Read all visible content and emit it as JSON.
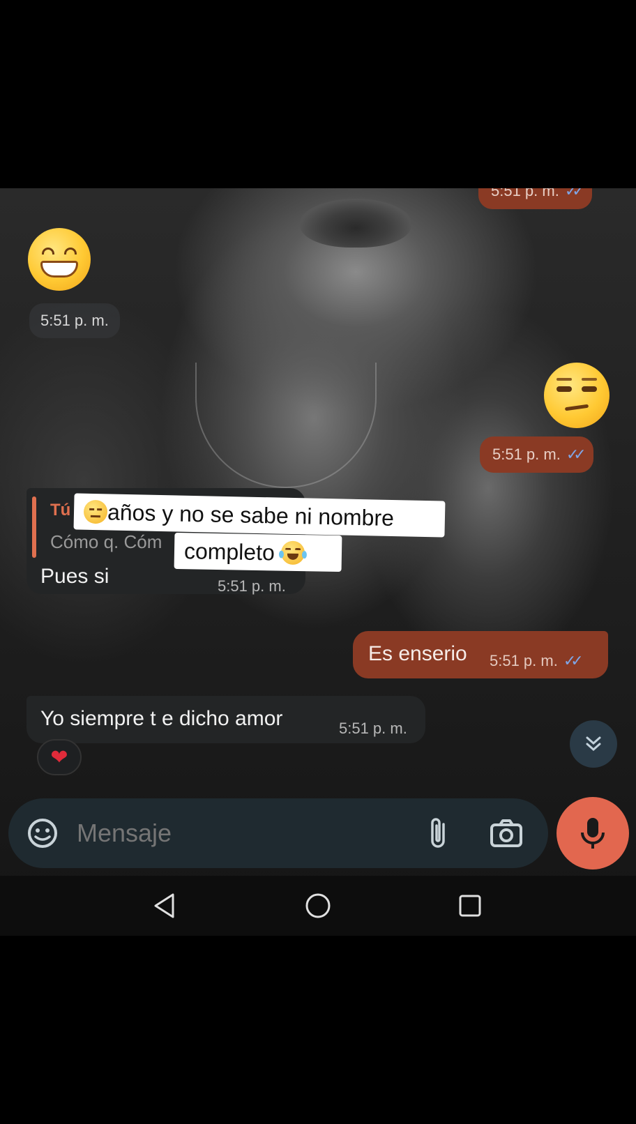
{
  "messages": {
    "top_out_time": "5:51 p. m.",
    "emoji_in_time": "5:51 p. m.",
    "emoji_out_time": "5:51 p. m.",
    "reply": {
      "quote_author": "Tú",
      "quote_text": "Cómo q. Cóm",
      "text": "Pues si",
      "time": "5:51 p. m."
    },
    "out_text": "Es enserio",
    "out_text_time": "5:51 p. m.",
    "in_text": "Yo siempre t e dicho amor",
    "in_text_time": "5:51 p. m.",
    "reaction": "heart"
  },
  "overlay": {
    "line1": "años y no se sabe ni nombre",
    "line2": "completo"
  },
  "input": {
    "placeholder": "Mensaje"
  },
  "icons": {
    "sticker": "sticker-icon",
    "attach": "paperclip-icon",
    "camera": "camera-icon",
    "mic": "microphone-icon",
    "scroll": "double-chevron-down-icon",
    "nav_back": "back-triangle-icon",
    "nav_home": "home-circle-icon",
    "nav_recents": "recents-square-icon"
  },
  "colors": {
    "outgoing_bubble": "#8a3a24",
    "incoming_bubble": "#232526",
    "accent": "#e2674f",
    "read_ticks": "#7fa7e8"
  }
}
